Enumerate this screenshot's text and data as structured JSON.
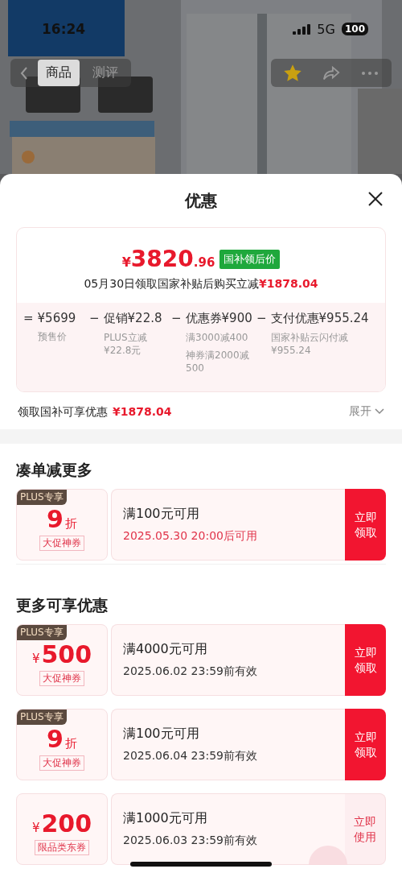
{
  "status_bar": {
    "time": "16:24",
    "network": "5G",
    "battery": "100"
  },
  "nav": {
    "tabs": [
      {
        "label": "商品",
        "selected": true
      },
      {
        "label": "测评",
        "selected": false
      }
    ],
    "favorited": true
  },
  "sheet": {
    "title": "优惠",
    "summary": {
      "currency": "¥",
      "integer": "3820",
      "decimal": ".96",
      "badge": "国补领后价",
      "subtitle": "05月30日领取国家补贴后购买立减",
      "subtitle_amount": "¥1878.04",
      "breakdown": [
        {
          "operator": "=",
          "value": "¥5699",
          "notes": [
            "预售价"
          ]
        },
        {
          "operator": "−",
          "label": "促销",
          "value": "¥22.8",
          "notes": [
            "PLUS立减¥22.8元"
          ]
        },
        {
          "operator": "−",
          "label": "优惠券",
          "value": "¥900",
          "notes": [
            "满3000减400",
            "神券满2000减500"
          ]
        },
        {
          "operator": "−",
          "label": "支付优惠",
          "value": "¥955.24",
          "notes": [
            "国家补贴云闪付减¥955.24"
          ]
        }
      ]
    },
    "subsidy_row": {
      "label": "领取国补可享优惠",
      "amount": "¥1878.04",
      "toggle": "展开",
      "expanded": false
    },
    "sections": [
      {
        "title": "凑单减更多",
        "coupons": [
          {
            "kind": "discount",
            "plus_tag": "PLUS专享",
            "amount": "9",
            "unit": "折",
            "type_tag": "大促神券",
            "condition": "满100元可用",
            "validity": "2025.05.30 20:00后可用",
            "pending": true,
            "action": "立即领取",
            "action_primary": true
          }
        ]
      },
      {
        "title": "更多可享优惠",
        "coupons": [
          {
            "kind": "cash",
            "plus_tag": "PLUS专享",
            "currency": "¥",
            "amount": "500",
            "type_tag": "大促神券",
            "condition": "满4000元可用",
            "validity": "2025.06.02 23:59前有效",
            "pending": false,
            "action": "立即领取",
            "action_primary": true
          },
          {
            "kind": "discount",
            "plus_tag": "PLUS专享",
            "amount": "9",
            "unit": "折",
            "type_tag": "大促神券",
            "condition": "满100元可用",
            "validity": "2025.06.04 23:59前有效",
            "pending": false,
            "action": "立即领取",
            "action_primary": true
          },
          {
            "kind": "cash",
            "currency": "¥",
            "amount": "200",
            "type_tag": "限品类东券",
            "condition": "满1000元可用",
            "validity": "2025.06.03 23:59前有效",
            "pending": false,
            "action": "立即使用",
            "action_primary": false,
            "claimed": true
          }
        ]
      }
    ]
  }
}
